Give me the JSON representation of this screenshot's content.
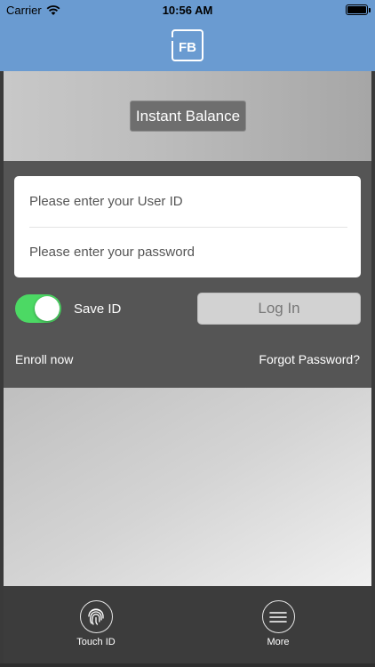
{
  "status_bar": {
    "carrier": "Carrier",
    "time": "10:56 AM",
    "icons": [
      "wifi-icon",
      "battery-icon"
    ]
  },
  "header": {
    "logo_text": "FB",
    "background_color": "#6a9bd1"
  },
  "instant_balance": {
    "label": "Instant Balance"
  },
  "login_form": {
    "user_id_placeholder": "Please enter your User ID",
    "password_placeholder": "Please enter your password",
    "save_id_label": "Save ID",
    "save_id_enabled": true,
    "login_label": "Log In",
    "enroll_label": "Enroll now",
    "forgot_label": "Forgot Password?"
  },
  "tab_bar": {
    "items": [
      {
        "label": "Touch ID",
        "icon": "fingerprint-icon"
      },
      {
        "label": "More",
        "icon": "menu-icon"
      }
    ]
  },
  "colors": {
    "toggle_on": "#4cd964",
    "panel": "#555555",
    "tab_bar": "#3c3c3c"
  }
}
